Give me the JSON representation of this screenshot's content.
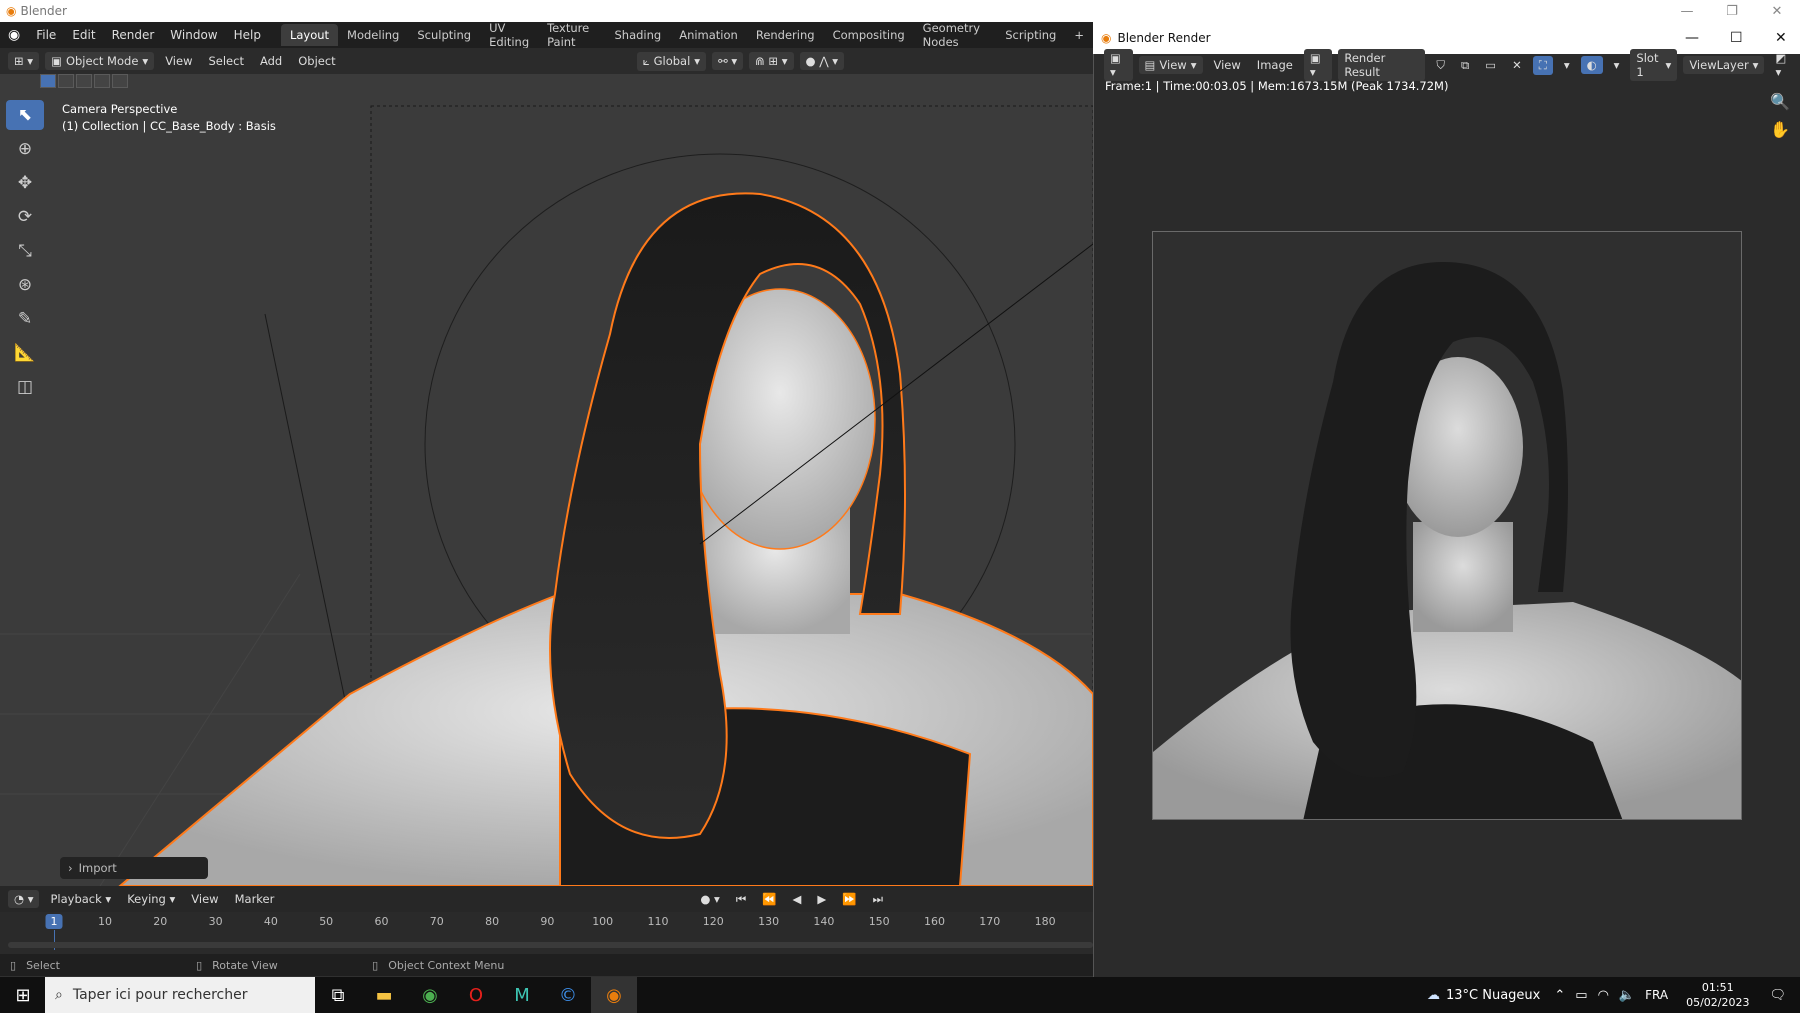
{
  "os": {
    "title": "Blender"
  },
  "menubar": {
    "items": [
      "File",
      "Edit",
      "Render",
      "Window",
      "Help"
    ]
  },
  "workspaces": {
    "tabs": [
      "Layout",
      "Modeling",
      "Sculpting",
      "UV Editing",
      "Texture Paint",
      "Shading",
      "Animation",
      "Rendering",
      "Compositing",
      "Geometry Nodes",
      "Scripting"
    ],
    "active": "Layout",
    "add": "+"
  },
  "viewport_header": {
    "mode": "Object Mode",
    "menus": [
      "View",
      "Select",
      "Add",
      "Object"
    ],
    "orientation": "Global"
  },
  "viewport": {
    "line1": "Camera Perspective",
    "line2": "(1) Collection | CC_Base_Body : Basis",
    "import_panel": "Import"
  },
  "timeline": {
    "menus": [
      "Playback",
      "Keying",
      "View",
      "Marker"
    ],
    "current_frame": "1",
    "frames": [
      "10",
      "20",
      "30",
      "40",
      "50",
      "60",
      "70",
      "80",
      "90",
      "100",
      "110",
      "120",
      "130",
      "140",
      "150",
      "160",
      "170",
      "180"
    ]
  },
  "statusbar": {
    "select": "Select",
    "rotate": "Rotate View",
    "context": "Object Context Menu"
  },
  "render_window": {
    "title": "Blender Render",
    "menus": [
      "View",
      "View",
      "Image"
    ],
    "result": "Render Result",
    "slot": "Slot 1",
    "view_layer": "ViewLayer",
    "info": "Frame:1 | Time:00:03.05 | Mem:1673.15M (Peak 1734.72M)"
  },
  "taskbar": {
    "search_placeholder": "Taper ici pour rechercher",
    "weather": "13°C  Nuageux",
    "lang": "FRA",
    "time": "01:51",
    "date": "05/02/2023"
  },
  "colors": {
    "accent": "#4772b3",
    "selection_outline": "#ff7a1a"
  }
}
